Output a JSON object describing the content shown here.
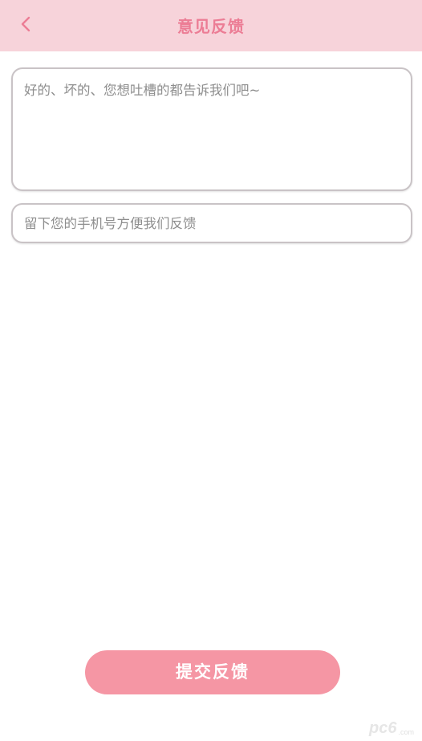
{
  "header": {
    "title": "意见反馈",
    "back_icon": "chevron-left-icon",
    "background_color": "#f7d3da",
    "title_color": "#ec7d95"
  },
  "form": {
    "feedback_placeholder": "好的、坏的、您想吐槽的都告诉我们吧~",
    "feedback_value": "",
    "phone_placeholder": "留下您的手机号方便我们反馈",
    "phone_value": ""
  },
  "submit": {
    "label": "提交反馈",
    "color": "#f596a4"
  },
  "watermark": {
    "text": "pc6",
    "sub": ".com"
  }
}
